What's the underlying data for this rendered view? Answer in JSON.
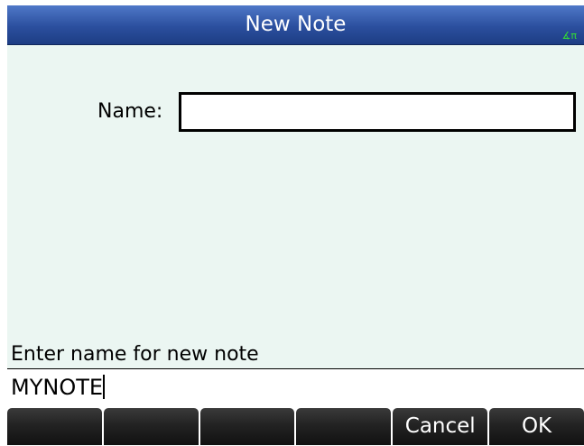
{
  "title_bar": {
    "title": "New Note",
    "angle_indicator": "∡π",
    "angle_indicator_color": "#33dd33"
  },
  "form": {
    "name_label": "Name:",
    "name_value": ""
  },
  "help_text": "Enter name for new note",
  "command_line": {
    "text": "MYNOTE"
  },
  "menu": {
    "keys": [
      "",
      "",
      "",
      "",
      "Cancel",
      "OK"
    ]
  },
  "colors": {
    "title_bar_blue": "#2b4f9e",
    "form_background": "#ebf6f2",
    "menu_key_black": "#1a1a1a"
  }
}
